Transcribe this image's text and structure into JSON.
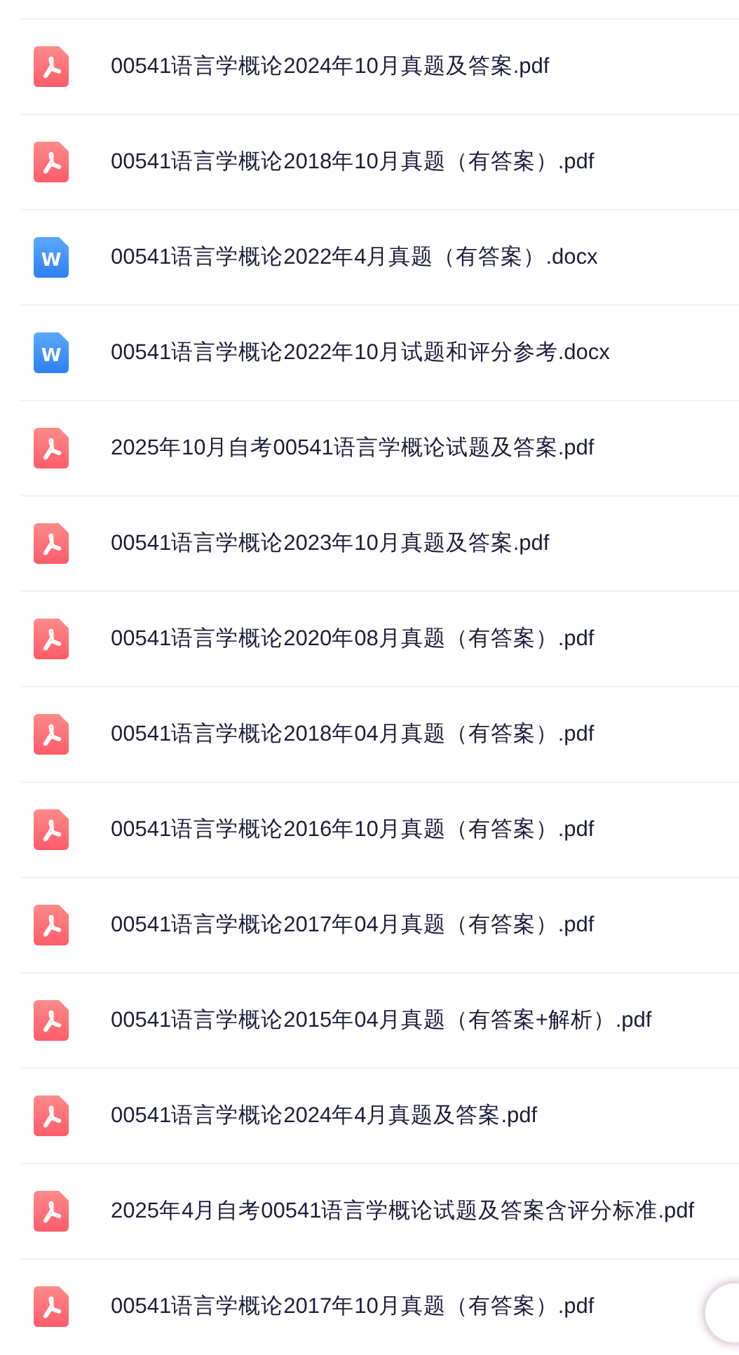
{
  "files": [
    {
      "kind": "pdf",
      "name": "00541语言学概论2024年10月真题及答案.pdf"
    },
    {
      "kind": "pdf",
      "name": "00541语言学概论2018年10月真题（有答案）.pdf"
    },
    {
      "kind": "word",
      "icon_text": "W",
      "name": "00541语言学概论2022年4月真题（有答案）.docx"
    },
    {
      "kind": "word",
      "icon_text": "W",
      "name": "00541语言学概论2022年10月试题和评分参考.docx"
    },
    {
      "kind": "pdf",
      "name": "2025年10月自考00541语言学概论试题及答案.pdf"
    },
    {
      "kind": "pdf",
      "name": "00541语言学概论2023年10月真题及答案.pdf"
    },
    {
      "kind": "pdf",
      "name": "00541语言学概论2020年08月真题（有答案）.pdf"
    },
    {
      "kind": "pdf",
      "name": "00541语言学概论2018年04月真题（有答案）.pdf"
    },
    {
      "kind": "pdf",
      "name": "00541语言学概论2016年10月真题（有答案）.pdf"
    },
    {
      "kind": "pdf",
      "name": "00541语言学概论2017年04月真题（有答案）.pdf"
    },
    {
      "kind": "pdf",
      "name": "00541语言学概论2015年04月真题（有答案+解析）.pdf"
    },
    {
      "kind": "pdf",
      "name": "00541语言学概论2024年4月真题及答案.pdf"
    },
    {
      "kind": "pdf",
      "name": "2025年4月自考00541语言学概论试题及答案含评分标准.pdf"
    },
    {
      "kind": "pdf",
      "name": "00541语言学概论2017年10月真题（有答案）.pdf"
    }
  ]
}
